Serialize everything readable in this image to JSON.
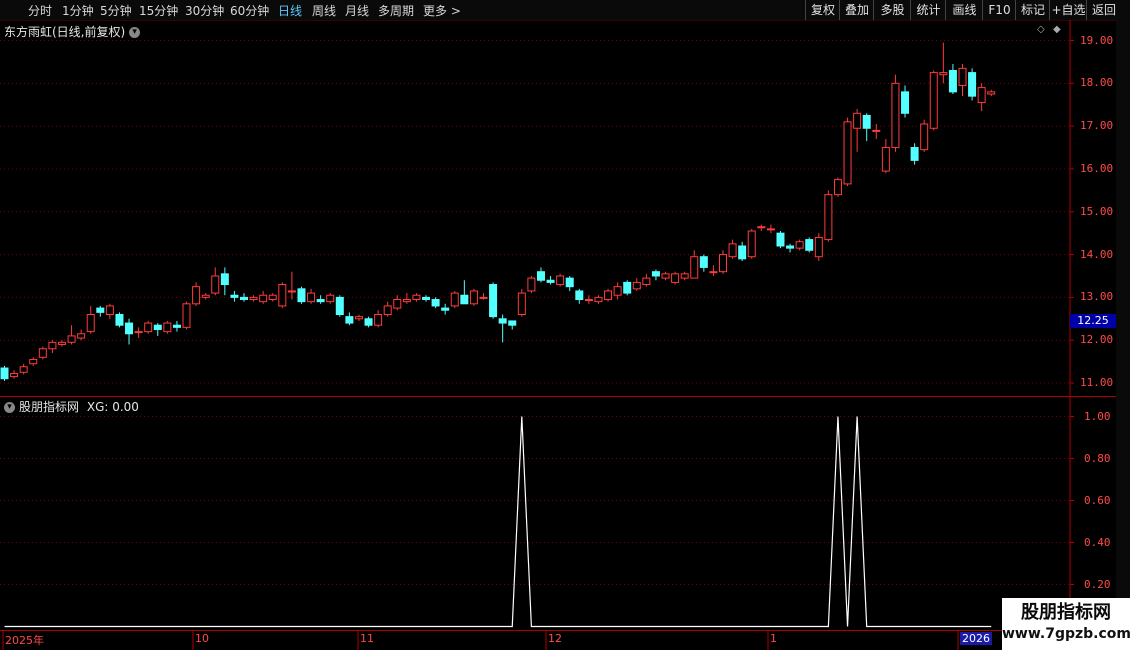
{
  "toolbar": {
    "periods": [
      {
        "label": "分时",
        "x": 28,
        "active": false
      },
      {
        "label": "1分钟",
        "x": 62,
        "active": false
      },
      {
        "label": "5分钟",
        "x": 100,
        "active": false
      },
      {
        "label": "15分钟",
        "x": 139,
        "active": false
      },
      {
        "label": "30分钟",
        "x": 185,
        "active": false
      },
      {
        "label": "60分钟",
        "x": 230,
        "active": false
      },
      {
        "label": "日线",
        "x": 278,
        "active": true
      },
      {
        "label": "周线",
        "x": 312,
        "active": false
      },
      {
        "label": "月线",
        "x": 345,
        "active": false
      },
      {
        "label": "多周期",
        "x": 378,
        "active": false
      },
      {
        "label": "更多",
        "x": 423,
        "active": false
      }
    ],
    "more_arrow": ">",
    "right_buttons": [
      "复权",
      "叠加",
      "多股",
      "统计",
      "画线",
      "F10",
      "标记",
      "+自选",
      "返回"
    ]
  },
  "main_chart": {
    "title": "东方雨虹(日线,前复权)",
    "current_price": "12.25",
    "y_ticks": [
      "19.00",
      "18.00",
      "17.00",
      "16.00",
      "15.00",
      "14.00",
      "13.00",
      "12.00",
      "11.00"
    ]
  },
  "indicator": {
    "title": "股朋指标网",
    "label": "XG: 0.00",
    "y_ticks": [
      "1.00",
      "0.80",
      "0.60",
      "0.40",
      "0.20"
    ]
  },
  "time_axis": {
    "labels": [
      "2025年",
      "10",
      "11",
      "12",
      "1",
      "2026"
    ]
  },
  "watermark": {
    "line1": "股朋指标网",
    "line2": "www.7gpzb.com"
  },
  "colors": {
    "up": "#ff3b3b",
    "down": "#54ffff",
    "grid": "#7a0000",
    "axis": "#b00000",
    "signal": "#ffffff"
  },
  "chart_data": {
    "type": "candlestick",
    "series_name": "东方雨虹",
    "ylim": [
      10.8,
      19.4
    ],
    "candles": [
      [
        11.35,
        11.1,
        11.4,
        11.05
      ],
      [
        11.15,
        11.22,
        11.3,
        11.1
      ],
      [
        11.25,
        11.38,
        11.45,
        11.2
      ],
      [
        11.45,
        11.55,
        11.6,
        11.4
      ],
      [
        11.6,
        11.8,
        11.85,
        11.55
      ],
      [
        11.8,
        11.95,
        12.0,
        11.7
      ],
      [
        11.9,
        11.95,
        12.0,
        11.85
      ],
      [
        11.95,
        12.1,
        12.35,
        11.9
      ],
      [
        12.05,
        12.15,
        12.25,
        12.0
      ],
      [
        12.2,
        12.6,
        12.8,
        12.15
      ],
      [
        12.75,
        12.65,
        12.8,
        12.55
      ],
      [
        12.6,
        12.8,
        12.85,
        12.5
      ],
      [
        12.6,
        12.35,
        12.65,
        12.3
      ],
      [
        12.4,
        12.15,
        12.5,
        11.9
      ],
      [
        12.2,
        12.2,
        12.3,
        12.05
      ],
      [
        12.2,
        12.4,
        12.45,
        12.15
      ],
      [
        12.35,
        12.25,
        12.4,
        12.1
      ],
      [
        12.2,
        12.4,
        12.45,
        12.15
      ],
      [
        12.35,
        12.3,
        12.45,
        12.2
      ],
      [
        12.3,
        12.85,
        12.9,
        12.25
      ],
      [
        12.85,
        13.25,
        13.35,
        12.8
      ],
      [
        13.0,
        13.05,
        13.1,
        12.95
      ],
      [
        13.1,
        13.5,
        13.7,
        13.05
      ],
      [
        13.55,
        13.3,
        13.7,
        13.05
      ],
      [
        13.05,
        13.0,
        13.15,
        12.9
      ],
      [
        13.0,
        12.95,
        13.1,
        12.9
      ],
      [
        12.95,
        13.0,
        13.05,
        12.9
      ],
      [
        12.9,
        13.05,
        13.15,
        12.85
      ],
      [
        12.95,
        13.05,
        13.1,
        12.9
      ],
      [
        12.8,
        13.3,
        13.35,
        12.75
      ],
      [
        13.15,
        13.15,
        13.6,
        12.95
      ],
      [
        13.2,
        12.9,
        13.25,
        12.85
      ],
      [
        12.9,
        13.1,
        13.2,
        12.85
      ],
      [
        12.95,
        12.9,
        13.05,
        12.85
      ],
      [
        12.9,
        13.05,
        13.1,
        12.85
      ],
      [
        13.0,
        12.6,
        13.05,
        12.55
      ],
      [
        12.55,
        12.4,
        12.65,
        12.35
      ],
      [
        12.5,
        12.55,
        12.6,
        12.45
      ],
      [
        12.5,
        12.35,
        12.55,
        12.3
      ],
      [
        12.35,
        12.6,
        12.7,
        12.3
      ],
      [
        12.6,
        12.8,
        12.9,
        12.55
      ],
      [
        12.75,
        12.95,
        13.05,
        12.7
      ],
      [
        12.9,
        12.95,
        13.1,
        12.85
      ],
      [
        12.95,
        13.05,
        13.1,
        12.9
      ],
      [
        13.0,
        12.95,
        13.05,
        12.9
      ],
      [
        12.95,
        12.8,
        13.0,
        12.75
      ],
      [
        12.75,
        12.7,
        12.85,
        12.6
      ],
      [
        12.8,
        13.1,
        13.15,
        12.75
      ],
      [
        13.05,
        12.85,
        13.4,
        12.85
      ],
      [
        12.85,
        13.15,
        13.2,
        12.8
      ],
      [
        13.0,
        13.0,
        13.1,
        12.95
      ],
      [
        13.3,
        12.55,
        13.35,
        12.5
      ],
      [
        12.5,
        12.4,
        12.6,
        11.95
      ],
      [
        12.45,
        12.35,
        12.45,
        12.25
      ],
      [
        12.6,
        13.1,
        13.2,
        12.55
      ],
      [
        13.15,
        13.45,
        13.5,
        13.1
      ],
      [
        13.6,
        13.4,
        13.7,
        13.35
      ],
      [
        13.4,
        13.35,
        13.5,
        13.3
      ],
      [
        13.3,
        13.5,
        13.55,
        13.25
      ],
      [
        13.45,
        13.25,
        13.5,
        13.15
      ],
      [
        13.15,
        12.95,
        13.2,
        12.85
      ],
      [
        12.95,
        12.95,
        13.05,
        12.85
      ],
      [
        12.9,
        13.0,
        13.05,
        12.85
      ],
      [
        12.95,
        13.15,
        13.2,
        12.9
      ],
      [
        13.05,
        13.25,
        13.35,
        12.95
      ],
      [
        13.35,
        13.1,
        13.4,
        13.05
      ],
      [
        13.2,
        13.35,
        13.45,
        13.15
      ],
      [
        13.3,
        13.45,
        13.55,
        13.25
      ],
      [
        13.6,
        13.5,
        13.65,
        13.4
      ],
      [
        13.45,
        13.55,
        13.6,
        13.4
      ],
      [
        13.35,
        13.55,
        13.6,
        13.3
      ],
      [
        13.45,
        13.55,
        13.6,
        13.4
      ],
      [
        13.45,
        13.95,
        14.1,
        13.45
      ],
      [
        13.95,
        13.7,
        14.0,
        13.6
      ],
      [
        13.6,
        13.6,
        13.75,
        13.5
      ],
      [
        13.6,
        14.0,
        14.1,
        13.55
      ],
      [
        13.95,
        14.25,
        14.35,
        13.9
      ],
      [
        14.2,
        13.9,
        14.3,
        13.85
      ],
      [
        13.95,
        14.55,
        14.6,
        13.9
      ],
      [
        14.65,
        14.65,
        14.7,
        14.55
      ],
      [
        14.6,
        14.6,
        14.7,
        14.5
      ],
      [
        14.5,
        14.2,
        14.55,
        14.15
      ],
      [
        14.2,
        14.15,
        14.25,
        14.05
      ],
      [
        14.15,
        14.3,
        14.35,
        14.1
      ],
      [
        14.35,
        14.1,
        14.4,
        14.05
      ],
      [
        13.95,
        14.4,
        14.5,
        13.85
      ],
      [
        14.35,
        15.4,
        15.5,
        14.3
      ],
      [
        15.4,
        15.75,
        15.8,
        15.35
      ],
      [
        15.65,
        17.1,
        17.2,
        15.6
      ],
      [
        16.95,
        17.3,
        17.4,
        16.4
      ],
      [
        17.25,
        16.95,
        17.3,
        16.65
      ],
      [
        16.9,
        16.9,
        17.05,
        16.7
      ],
      [
        15.95,
        16.5,
        16.7,
        15.9
      ],
      [
        16.5,
        18.0,
        18.2,
        16.4
      ],
      [
        17.8,
        17.3,
        17.95,
        17.2
      ],
      [
        16.5,
        16.2,
        16.6,
        16.1
      ],
      [
        16.45,
        17.05,
        17.15,
        16.4
      ],
      [
        16.95,
        18.25,
        18.3,
        16.9
      ],
      [
        18.2,
        18.25,
        18.95,
        18.0
      ],
      [
        18.3,
        17.8,
        18.45,
        17.75
      ],
      [
        17.95,
        18.35,
        18.45,
        17.7
      ],
      [
        18.25,
        17.7,
        18.35,
        17.6
      ],
      [
        17.55,
        17.9,
        18.0,
        17.35
      ],
      [
        17.75,
        17.8,
        17.85,
        17.7
      ]
    ]
  },
  "signal_data": {
    "type": "line",
    "name": "XG",
    "ylim": [
      0,
      1.05
    ],
    "spikes_at": [
      54,
      87,
      89
    ]
  }
}
